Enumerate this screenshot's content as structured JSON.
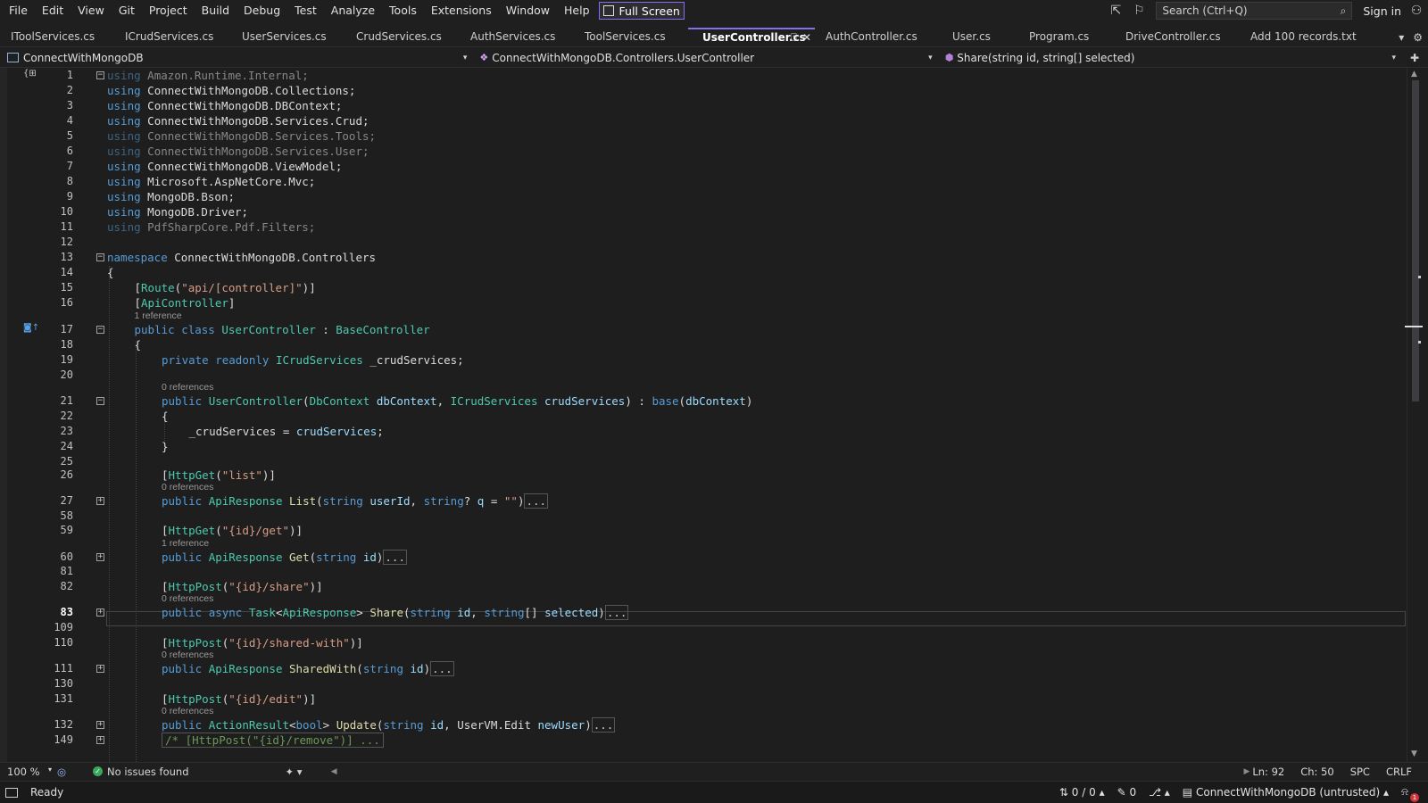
{
  "menu": [
    "File",
    "Edit",
    "View",
    "Git",
    "Project",
    "Build",
    "Debug",
    "Test",
    "Analyze",
    "Tools",
    "Extensions",
    "Window",
    "Help"
  ],
  "fullscreen_label": "Full Screen",
  "search_placeholder": "Search (Ctrl+Q)",
  "signin_label": "Sign in",
  "tabs": [
    "IToolServices.cs",
    "ICrudServices.cs",
    "UserServices.cs",
    "CrudServices.cs",
    "AuthServices.cs",
    "ToolServices.cs",
    "UserController.cs",
    "AuthController.cs",
    "User.cs",
    "Program.cs",
    "DriveController.cs",
    "Add 100 records.txt"
  ],
  "nav": {
    "project": "ConnectWithMongoDB",
    "type": "ConnectWithMongoDB.Controllers.UserController",
    "member": "Share(string id, string[] selected)"
  },
  "lines": [
    {
      "n": "1",
      "t": "using Amazon.Runtime.Internal;"
    },
    {
      "n": "2",
      "t": "using ConnectWithMongoDB.Collections;"
    },
    {
      "n": "3",
      "t": "using ConnectWithMongoDB.DBContext;"
    },
    {
      "n": "4",
      "t": "using ConnectWithMongoDB.Services.Crud;"
    },
    {
      "n": "5",
      "t": "using ConnectWithMongoDB.Services.Tools;"
    },
    {
      "n": "6",
      "t": "using ConnectWithMongoDB.Services.User;"
    },
    {
      "n": "7",
      "t": "using ConnectWithMongoDB.ViewModel;"
    },
    {
      "n": "8",
      "t": "using Microsoft.AspNetCore.Mvc;"
    },
    {
      "n": "9",
      "t": "using MongoDB.Bson;"
    },
    {
      "n": "10",
      "t": "using MongoDB.Driver;"
    },
    {
      "n": "11",
      "t": "using PdfSharpCore.Pdf.Filters;"
    },
    {
      "n": "12",
      "t": ""
    },
    {
      "n": "13",
      "t": "namespace ConnectWithMongoDB.Controllers"
    },
    {
      "n": "14",
      "t": "{"
    },
    {
      "n": "15",
      "t": "[Route(\"api/[controller]\")]"
    },
    {
      "n": "16",
      "t": "[ApiController]"
    },
    {
      "n": "17",
      "t": "public class UserController : BaseController"
    },
    {
      "n": "18",
      "t": "{"
    },
    {
      "n": "19",
      "t": "private readonly ICrudServices _crudServices;"
    },
    {
      "n": "20",
      "t": ""
    },
    {
      "n": "21",
      "t": "public UserController(DbContext dbContext, ICrudServices crudServices) : base(dbContext)"
    },
    {
      "n": "22",
      "t": "{"
    },
    {
      "n": "23",
      "t": "_crudServices = crudServices;"
    },
    {
      "n": "24",
      "t": "}"
    },
    {
      "n": "25",
      "t": ""
    },
    {
      "n": "26",
      "t": "[HttpGet(\"list\")]"
    },
    {
      "n": "27",
      "t": "public ApiResponse List(string userId, string? q = \"\")"
    },
    {
      "n": "58",
      "t": ""
    },
    {
      "n": "59",
      "t": "[HttpGet(\"{id}/get\")]"
    },
    {
      "n": "60",
      "t": "public ApiResponse Get(string id)"
    },
    {
      "n": "81",
      "t": ""
    },
    {
      "n": "82",
      "t": "[HttpPost(\"{id}/share\")]"
    },
    {
      "n": "83",
      "t": "public async Task<ApiResponse> Share(string id, string[] selected)"
    },
    {
      "n": "109",
      "t": ""
    },
    {
      "n": "110",
      "t": "[HttpPost(\"{id}/shared-with\")]"
    },
    {
      "n": "111",
      "t": "public ApiResponse SharedWith(string id)"
    },
    {
      "n": "130",
      "t": ""
    },
    {
      "n": "131",
      "t": "[HttpPost(\"{id}/edit\")]"
    },
    {
      "n": "132",
      "t": "public ActionResult<bool> Update(string id, UserVM.Edit newUser)"
    },
    {
      "n": "149",
      "t": "/* [HttpPost(\"{id}/remove\")] ..."
    }
  ],
  "lens": {
    "one": "1 reference",
    "zero": "0 references"
  },
  "collapsed": "...",
  "status": {
    "zoom": "100 %",
    "issues": "No issues found",
    "ln": "Ln: 92",
    "ch": "Ch: 50",
    "spc": "SPC",
    "eol": "CRLF",
    "ready": "Ready",
    "git_changes": "0 / 0",
    "edits": "0",
    "repo": "ConnectWithMongoDB (untrusted)",
    "notifications": "1"
  }
}
